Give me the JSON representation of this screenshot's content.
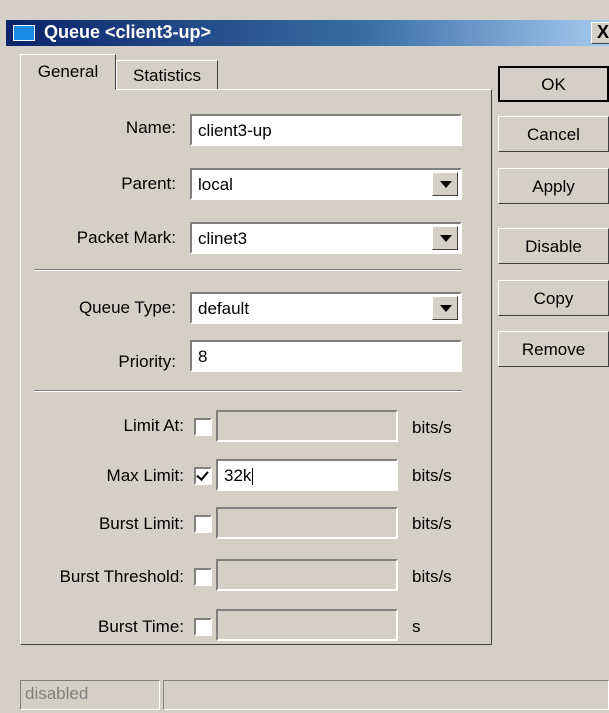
{
  "window": {
    "title": "Queue <client3-up>",
    "close_label": "X"
  },
  "tabs": [
    {
      "label": "General",
      "active": true
    },
    {
      "label": "Statistics",
      "active": false
    }
  ],
  "form": {
    "name": {
      "label": "Name:",
      "value": "client3-up"
    },
    "parent": {
      "label": "Parent:",
      "value": "local"
    },
    "packet_mark": {
      "label": "Packet Mark:",
      "value": "clinet3"
    },
    "queue_type": {
      "label": "Queue Type:",
      "value": "default"
    },
    "priority": {
      "label": "Priority:",
      "value": "8"
    },
    "limit_at": {
      "label": "Limit At:",
      "checked": false,
      "value": "",
      "unit": "bits/s"
    },
    "max_limit": {
      "label": "Max Limit:",
      "checked": true,
      "value": "32k",
      "unit": "bits/s"
    },
    "burst_limit": {
      "label": "Burst Limit:",
      "checked": false,
      "value": "",
      "unit": "bits/s"
    },
    "burst_threshold": {
      "label": "Burst Threshold:",
      "checked": false,
      "value": "",
      "unit": "bits/s"
    },
    "burst_time": {
      "label": "Burst Time:",
      "checked": false,
      "value": "",
      "unit": "s"
    }
  },
  "buttons": {
    "ok": "OK",
    "cancel": "Cancel",
    "apply": "Apply",
    "disable": "Disable",
    "copy": "Copy",
    "remove": "Remove"
  },
  "status": {
    "state": "disabled"
  },
  "colors": {
    "titlebar_start": "#0a246a",
    "titlebar_end": "#a6caf0",
    "face": "#d4d0c8"
  }
}
